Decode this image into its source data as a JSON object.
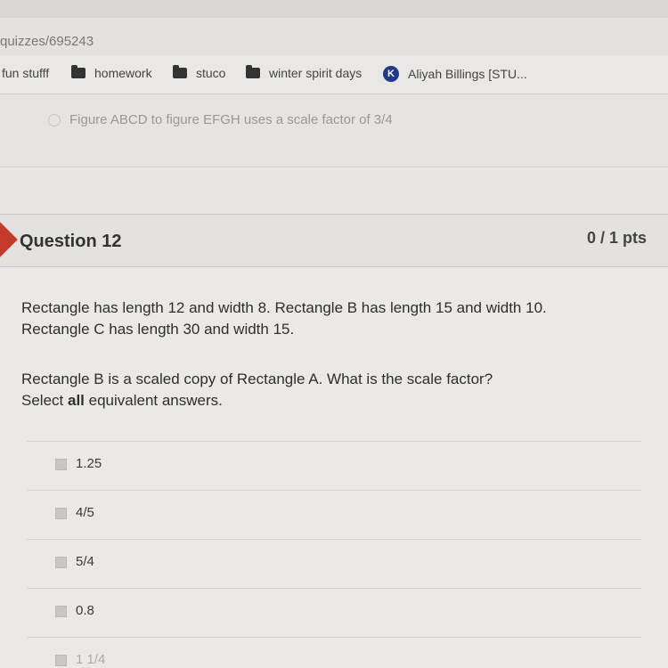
{
  "browser": {
    "url_fragment": "quizzes/695243"
  },
  "bookmarks": [
    {
      "label": "fun stufff",
      "icon": "none"
    },
    {
      "label": "homework",
      "icon": "folder-icon"
    },
    {
      "label": "stuco",
      "icon": "folder-icon"
    },
    {
      "label": "winter spirit days",
      "icon": "folder-icon"
    },
    {
      "label": "Aliyah Billings [STU...",
      "icon": "k-icon",
      "icon_glyph": "K"
    }
  ],
  "previous_answer": {
    "text": "Figure ABCD to figure EFGH uses a scale factor of 3/4"
  },
  "question": {
    "title": "Question 12",
    "points": "0 / 1 pts",
    "line1": "Rectangle  has length 12 and width 8. Rectangle B has length 15 and width 10.",
    "line2": "Rectangle C has length 30 and width 15.",
    "prompt1": "Rectangle B is a scaled copy of Rectangle A. What is the scale factor?",
    "prompt2_before": "Select ",
    "prompt2_bold": "all",
    "prompt2_after": " equivalent answers.",
    "answers": [
      "1.25",
      "4/5",
      "5/4",
      "0.8",
      "1 1/4"
    ]
  },
  "colors": {
    "marker": "#c43b2c",
    "k_icon": "#1f3a8a"
  }
}
